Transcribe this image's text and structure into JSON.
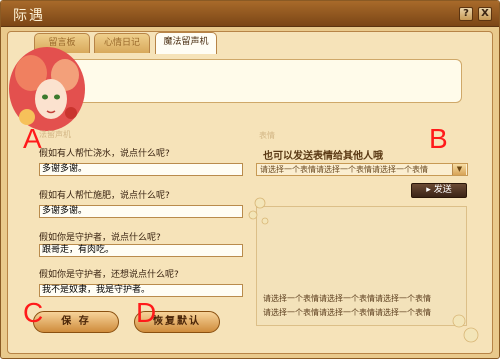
{
  "window": {
    "title": "际遇"
  },
  "titlebar_buttons": {
    "help": "?",
    "close": "X"
  },
  "tabs": [
    {
      "label": "留言板"
    },
    {
      "label": "心情日记"
    },
    {
      "label": "魔法留声机"
    }
  ],
  "left_section_title": "法留声机",
  "questions": [
    {
      "label": "假如有人帮忙浇水，说点什么呢?",
      "value": "多谢多谢。"
    },
    {
      "label": "假如有人帮忙施肥，说点什么呢?",
      "value": "多谢多谢。"
    },
    {
      "label": "假如你是守护者，说点什么呢?",
      "value": "跟哥走，有肉吃。"
    },
    {
      "label": "假如你是守护者，还想说点什么呢?",
      "value": "我不是奴隶，我是守护者。"
    }
  ],
  "emote": {
    "section_title": "表情",
    "heading": "也可以发送表情给其他人哦",
    "select_value": "请选择一个表情请选择一个表情请选择一个表情",
    "send_label": "发送",
    "lines": [
      "请选择一个表情请选择一个表情请选择一个表情",
      "请选择一个表情请选择一个表情请选择一个表情"
    ]
  },
  "buttons": {
    "save": "保 存",
    "reset": "恢复默认"
  },
  "markers": {
    "a": "A",
    "b": "B",
    "c": "C",
    "d": "D"
  },
  "icons": {
    "dropdown": "chevron-down-icon",
    "send": "send-icon"
  }
}
